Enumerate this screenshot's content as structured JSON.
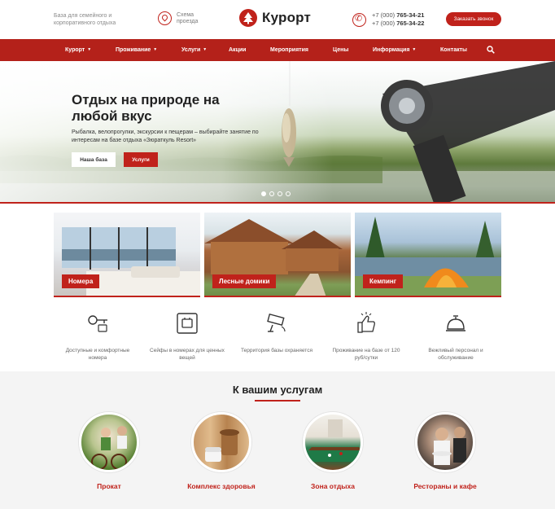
{
  "header": {
    "tagline": "База для семейного и корпоративного отдыха",
    "route_label": "Схема проезда",
    "logo_text": "Курорт",
    "phone_prefix_1": "+7 (000)",
    "phone_number_1": "765-34-21",
    "phone_prefix_2": "+7 (000)",
    "phone_number_2": "765-34-22",
    "callback_label": "Заказать звонок"
  },
  "nav": {
    "items": [
      {
        "label": "Курорт",
        "has_dropdown": true
      },
      {
        "label": "Проживание",
        "has_dropdown": true
      },
      {
        "label": "Услуги",
        "has_dropdown": true
      },
      {
        "label": "Акции",
        "has_dropdown": false
      },
      {
        "label": "Мероприятия",
        "has_dropdown": false
      },
      {
        "label": "Цены",
        "has_dropdown": false
      },
      {
        "label": "Информация",
        "has_dropdown": true
      },
      {
        "label": "Контакты",
        "has_dropdown": false
      }
    ],
    "search_icon": "search-icon"
  },
  "hero": {
    "title": "Отдых на природе на любой вкус",
    "subtitle": "Рыбалка, велопрогулки, экскурсии к пещерам – выбирайте занятие по интересам на базе отдыха «Зюраткуль Resort»",
    "button_primary": "Наша база",
    "button_secondary": "Услуги",
    "slides_total": 4,
    "active_slide": 1
  },
  "categories": [
    {
      "label": "Номера"
    },
    {
      "label": "Лесные домики"
    },
    {
      "label": "Кемпинг"
    }
  ],
  "features": [
    {
      "icon": "key-icon",
      "text": "Доступные и комфортные номера"
    },
    {
      "icon": "safe-icon",
      "text": "Сейфы в номерах для ценных вещей"
    },
    {
      "icon": "security-camera-icon",
      "text": "Территория базы охраняется"
    },
    {
      "icon": "thumbs-up-icon",
      "text": "Проживание на базе от 120 руб/сутки"
    },
    {
      "icon": "reception-bell-icon",
      "text": "Вежливый персонал и обслуживание"
    }
  ],
  "services": {
    "title": "К вашим услугам",
    "items": [
      {
        "label": "Прокат"
      },
      {
        "label": "Комплекс здоровья"
      },
      {
        "label": "Зона отдыха"
      },
      {
        "label": "Рестораны и кафе"
      }
    ]
  },
  "colors": {
    "accent": "#c0221b",
    "nav_bg": "#b4211a",
    "services_bg": "#f4f4f4"
  }
}
